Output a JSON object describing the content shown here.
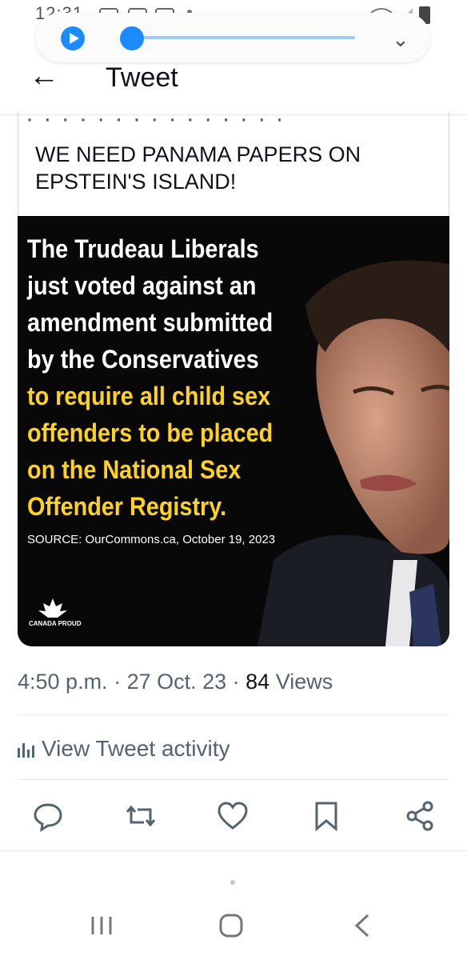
{
  "status_bar": {
    "time": "12:31"
  },
  "media_player": {
    "progress": 0.05
  },
  "header": {
    "title": "Tweet"
  },
  "quoted": {
    "cut_text": "· · · · · · · · · · · · · · ·",
    "text": "WE NEED PANAMA PAPERS ON EPSTEIN'S ISLAND!"
  },
  "image": {
    "white_lines": [
      "The Trudeau Liberals",
      "just voted against an",
      "amendment submitted",
      "by the Conservatives"
    ],
    "yellow_lines": [
      "to require all child sex",
      "offenders to be placed",
      "on the National Sex",
      "Offender Registry."
    ],
    "source": "SOURCE: OurCommons.ca, October 19, 2023",
    "logo_text": "CANADA PROUD"
  },
  "meta": {
    "time": "4:50 p.m.",
    "sep1": " · ",
    "date": "27 Oct. 23",
    "sep2": " · ",
    "views_count": "84",
    "views_label": " Views"
  },
  "activity": {
    "label": "View Tweet activity"
  },
  "actions": [
    "reply-icon",
    "retweet-icon",
    "like-icon",
    "bookmark-icon",
    "share-icon"
  ]
}
